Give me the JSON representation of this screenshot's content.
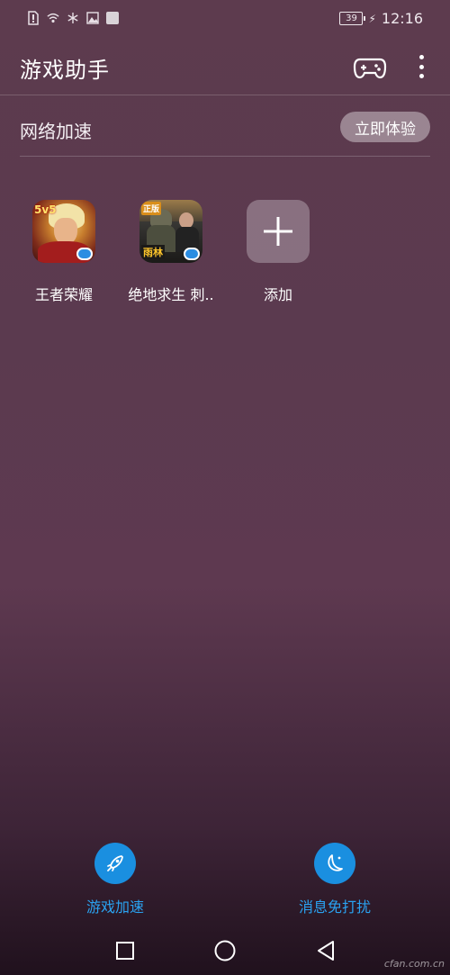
{
  "status_bar": {
    "battery_level": "39",
    "time": "12:16",
    "icons": [
      "alert-sim-icon",
      "wifi-icon",
      "snowflake-icon",
      "gallery-icon",
      "square-icon"
    ]
  },
  "app_bar": {
    "title": "游戏助手",
    "icons": [
      "gamepad-icon",
      "more-vert-icon"
    ]
  },
  "network": {
    "label": "网络加速",
    "button": "立即体验"
  },
  "games": [
    {
      "name": "王者荣耀",
      "icon_tag": "5v5"
    },
    {
      "name": "绝地求生 刺..",
      "icon_tag": "正版",
      "icon_label": "雨林"
    },
    {
      "name": "添加",
      "icon": "plus-icon"
    }
  ],
  "actions": [
    {
      "label": "游戏加速",
      "icon": "rocket-icon"
    },
    {
      "label": "消息免打扰",
      "icon": "moon-icon"
    }
  ],
  "nav": [
    "recent-apps-icon",
    "home-icon",
    "back-icon"
  ],
  "watermark": "cfan.com.cn",
  "colors": {
    "accent": "#1a8fe0",
    "accent_text": "#2aa3f2",
    "background_top": "#5d3b4e",
    "background_bottom": "#20111d"
  }
}
